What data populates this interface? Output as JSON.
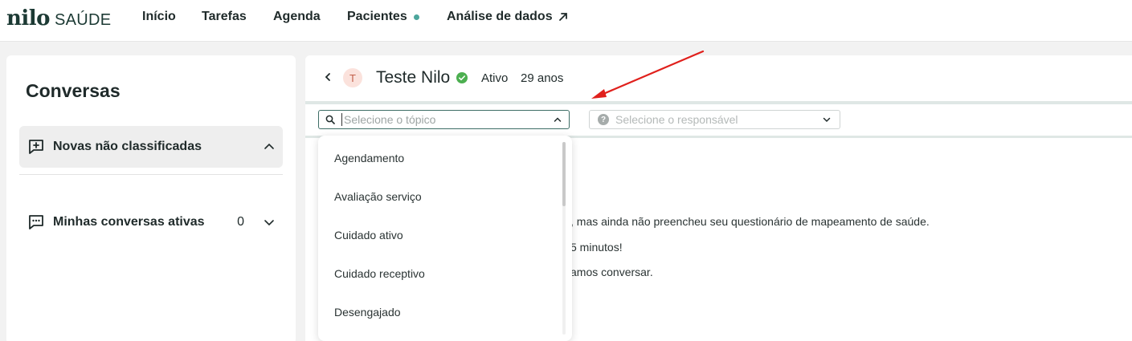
{
  "brand": {
    "name": "nilo",
    "suffix": "SAÚDE"
  },
  "nav": {
    "items": [
      {
        "label": "Início"
      },
      {
        "label": "Tarefas"
      },
      {
        "label": "Agenda"
      },
      {
        "label": "Pacientes"
      },
      {
        "label": "Análise de dados"
      }
    ]
  },
  "sidebar": {
    "title": "Conversas",
    "sections": [
      {
        "label": "Novas não classificadas",
        "count": ""
      },
      {
        "label": "Minhas conversas ativas",
        "count": "0"
      }
    ]
  },
  "patient": {
    "initial": "T",
    "name": "Teste Nilo",
    "status": "Ativo",
    "age": "29 anos"
  },
  "filters": {
    "topic_placeholder": "Selecione o tópico",
    "responsible_placeholder": "Selecione o responsável"
  },
  "messages": [
    ", mas ainda não preencheu seu questionário de mapeamento de saúde.",
    "5 minutos!",
    "amos conversar."
  ],
  "topic_options": [
    "Agendamento",
    "Avaliação serviço",
    "Cuidado ativo",
    "Cuidado receptivo",
    "Desengajado"
  ],
  "colors": {
    "accent": "#4ca69c",
    "brand": "#1c3a34",
    "annotation": "#e0201c",
    "verified": "#4caf50"
  }
}
